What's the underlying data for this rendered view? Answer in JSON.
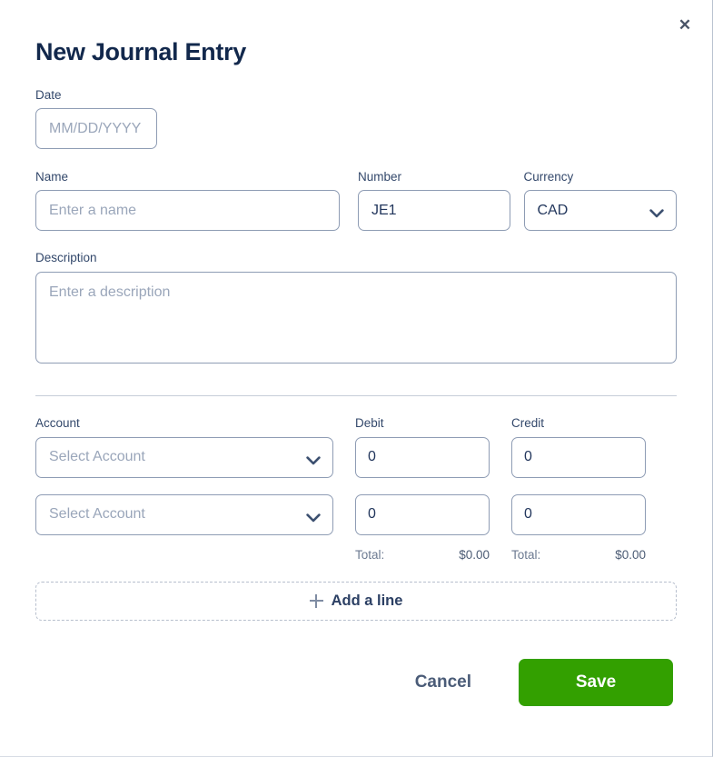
{
  "modal": {
    "title": "New Journal Entry",
    "close_label": "✕"
  },
  "form": {
    "date": {
      "label": "Date",
      "placeholder": "MM/DD/YYYY",
      "value": ""
    },
    "name": {
      "label": "Name",
      "placeholder": "Enter a name",
      "value": ""
    },
    "number": {
      "label": "Number",
      "placeholder": "",
      "value": "JE1"
    },
    "currency": {
      "label": "Currency",
      "value": "CAD",
      "options": [
        "CAD"
      ]
    },
    "description": {
      "label": "Description",
      "placeholder": "Enter a description",
      "value": ""
    }
  },
  "lines": {
    "headers": {
      "account": "Account",
      "debit": "Debit",
      "credit": "Credit"
    },
    "rows": [
      {
        "account": "Select Account",
        "debit": "0",
        "credit": "0"
      },
      {
        "account": "Select Account",
        "debit": "0",
        "credit": "0"
      }
    ],
    "totals": {
      "label": "Total:",
      "debit": "$0.00",
      "credit": "$0.00"
    },
    "add_line_label": "Add a line"
  },
  "footer": {
    "cancel_label": "Cancel",
    "save_label": "Save"
  },
  "colors": {
    "title": "#12284c",
    "border": "#8e9cb4",
    "placeholder": "#9aa6ba",
    "save_button": "#33a000",
    "dashed_border": "#b7bfcd",
    "divider": "#c6cdd8"
  }
}
